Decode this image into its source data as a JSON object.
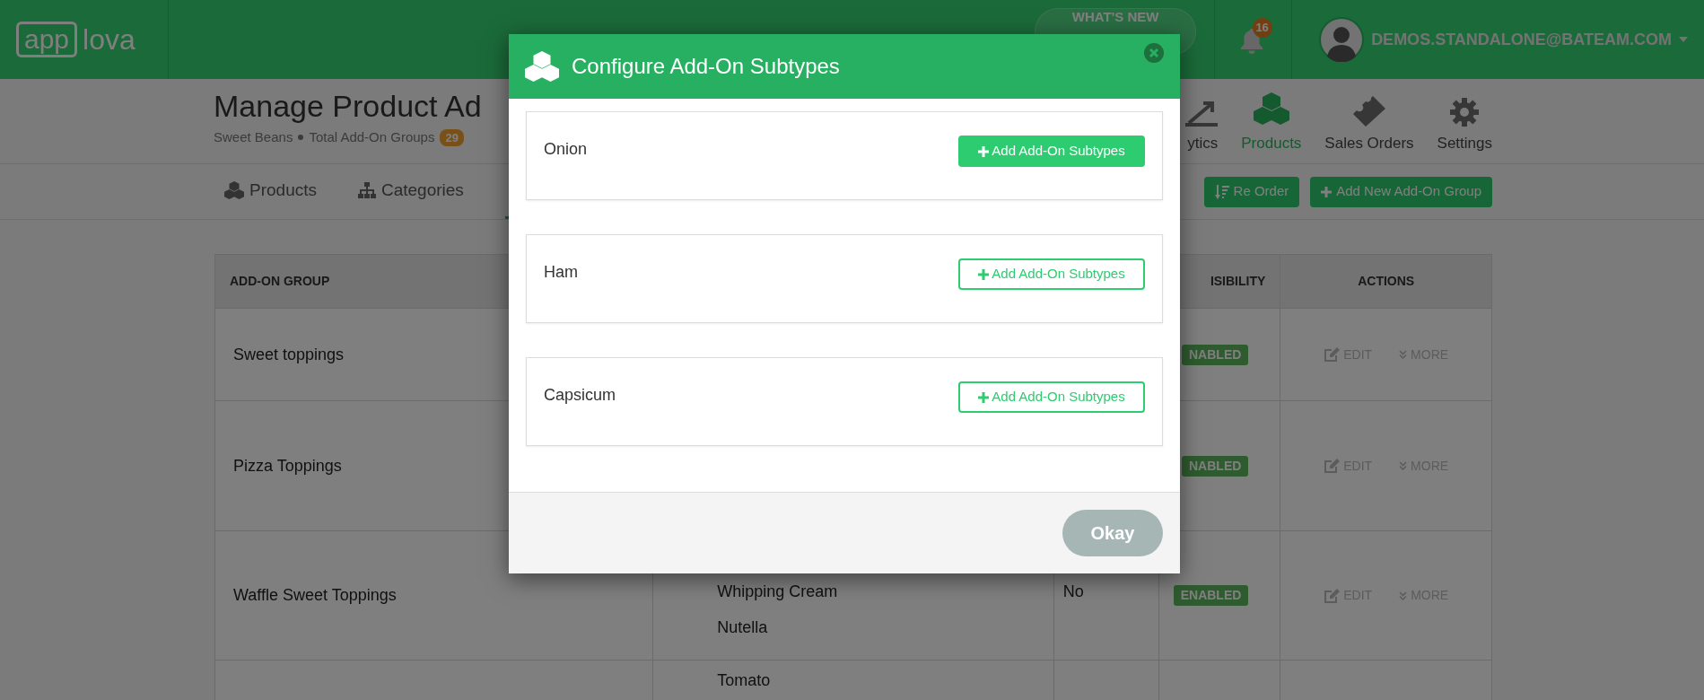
{
  "header": {
    "logo": {
      "left": "app",
      "right": "lova"
    },
    "whats_new": "WHAT'S NEW",
    "notifications": "16",
    "user_email": "DEMOS.STANDALONE@BATEAM.COM"
  },
  "page": {
    "title": "Manage Product Ad",
    "store": "Sweet Beans",
    "total_label": "Total Add-On Groups",
    "total_count": "29"
  },
  "nav": [
    {
      "label": "ytics",
      "selected": false
    },
    {
      "label": "Products",
      "selected": true
    },
    {
      "label": "Sales Orders",
      "selected": false
    },
    {
      "label": "Settings",
      "selected": false
    }
  ],
  "tabs": [
    {
      "label": "Products",
      "selected": false
    },
    {
      "label": "Categories",
      "selected": false
    }
  ],
  "toolbar_buttons": [
    "Re Order",
    "Add New Add-On Group"
  ],
  "table": {
    "columns": [
      "ADD-ON GROUP",
      "ISIBILITY",
      "ACTIONS"
    ],
    "rows": [
      {
        "group": "Sweet toppings",
        "visibility": "NABLED",
        "actions": [
          "EDIT",
          "MORE"
        ]
      },
      {
        "group": "Pizza Toppings",
        "visibility": "NABLED",
        "actions": [
          "EDIT",
          "MORE"
        ]
      },
      {
        "group": "Waffle Sweet Toppings",
        "subtypes": [
          "Whipping Cream",
          "Nutella"
        ],
        "column_3": "No",
        "visibility": "ENABLED",
        "actions": [
          "EDIT",
          "MORE"
        ]
      },
      {
        "subtypes": [
          "Tomato"
        ]
      }
    ]
  },
  "modal": {
    "title": "Configure Add-On Subtypes",
    "items": [
      {
        "name": "Onion",
        "button": "Add Add-On Subtypes",
        "selected": true
      },
      {
        "name": "Ham",
        "button": "Add Add-On Subtypes",
        "selected": false
      },
      {
        "name": "Capsicum",
        "button": "Add Add-On Subtypes",
        "selected": false
      }
    ],
    "ok_button": "Okay"
  }
}
